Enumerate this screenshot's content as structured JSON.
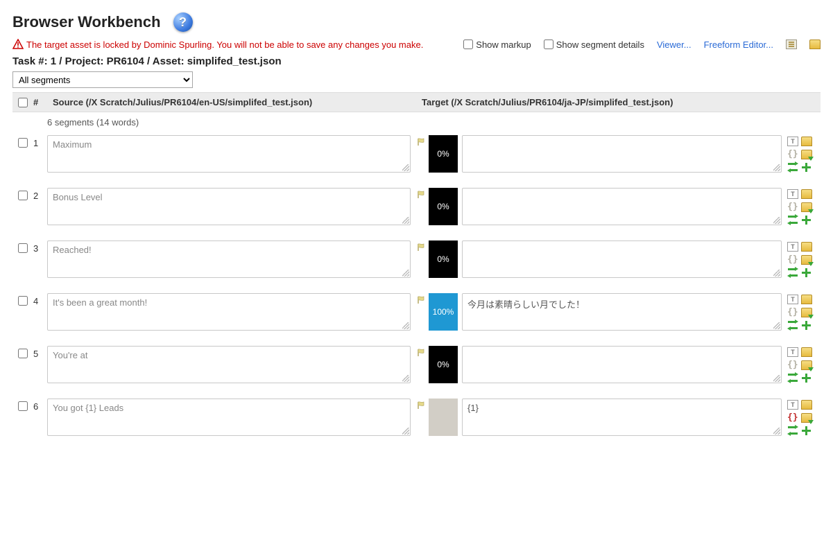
{
  "title": "Browser Workbench",
  "warning": "The target asset is locked by Dominic Spurling. You will not be able to save any changes you make.",
  "controls": {
    "show_markup": "Show markup",
    "show_segment_details": "Show segment details",
    "viewer_link": "Viewer...",
    "freeform_link": "Freeform Editor..."
  },
  "task_label": "Task #: 1 / Project: PR6104 / Asset: simplifed_test.json",
  "filter_options": [
    "All segments"
  ],
  "filter_selected": "All segments",
  "columns": {
    "num": "#",
    "source": "Source (/X Scratch/Julius/PR6104/en-US/simplifed_test.json)",
    "target": "Target (/X Scratch/Julius/PR6104/ja-JP/simplifed_test.json)"
  },
  "segment_count": "6 segments (14 words)",
  "rows": [
    {
      "num": "1",
      "source": "Maximum",
      "match": "0%",
      "match_style": "black",
      "target": "",
      "brackets_red": false
    },
    {
      "num": "2",
      "source": "Bonus Level",
      "match": "0%",
      "match_style": "black",
      "target": "",
      "brackets_red": false
    },
    {
      "num": "3",
      "source": "Reached!",
      "match": "0%",
      "match_style": "black",
      "target": "",
      "brackets_red": false
    },
    {
      "num": "4",
      "source": "It's been a great month!",
      "match": "100%",
      "match_style": "blue",
      "target": "今月は素晴らしい月でした！",
      "brackets_red": false
    },
    {
      "num": "5",
      "source": "You're at",
      "match": "0%",
      "match_style": "black",
      "target": "",
      "brackets_red": false
    },
    {
      "num": "6",
      "source": "You got {1} Leads",
      "match": "",
      "match_style": "grey",
      "target": "{1}",
      "brackets_red": true
    }
  ]
}
